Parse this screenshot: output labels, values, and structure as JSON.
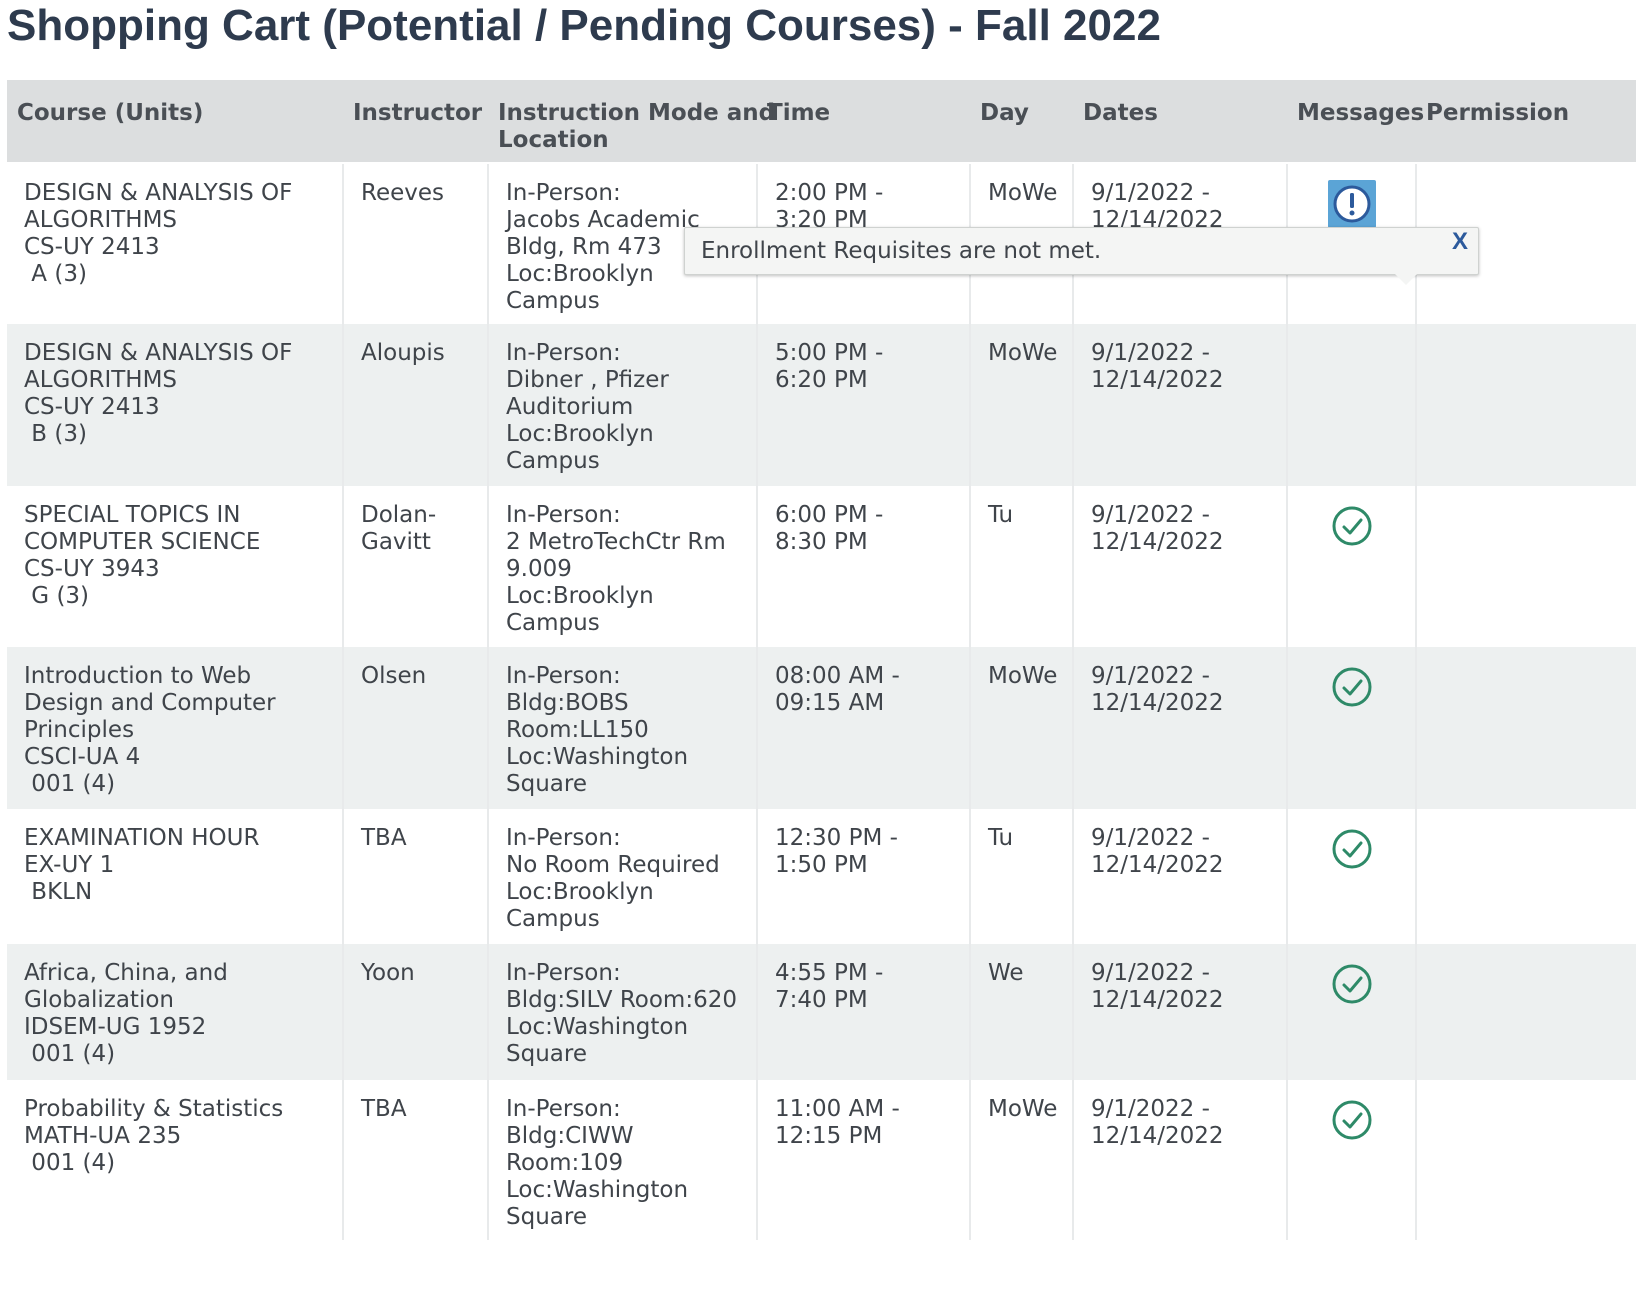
{
  "page": {
    "title": "Shopping Cart (Potential / Pending Courses) - Fall 2022"
  },
  "table": {
    "headers": {
      "course": "Course (Units)",
      "instructor": "Instructor",
      "mode_line1": "Instruction Mode and",
      "mode_line2": "Location",
      "time": "Time",
      "day": "Day",
      "dates": "Dates",
      "messages": "Messages",
      "permission": "Permission"
    },
    "rows": [
      {
        "title": [
          "DESIGN & ANALYSIS OF",
          "ALGORITHMS"
        ],
        "code": "CS-UY 2413",
        "section": " A (3)",
        "instructor": [
          "Reeves"
        ],
        "location": [
          "In-Person:",
          "Jacobs Academic",
          "Bldg, Rm 473",
          "Loc:Brooklyn",
          "Campus"
        ],
        "time": [
          "2:00 PM -",
          "3:20 PM"
        ],
        "day": "MoWe",
        "dates": [
          "9/1/2022 -",
          "12/14/2022"
        ],
        "message": "warning",
        "message_icon": "exclamation-icon",
        "permission": ""
      },
      {
        "title": [
          "DESIGN & ANALYSIS OF",
          "ALGORITHMS"
        ],
        "code": "CS-UY 2413",
        "section": " B (3)",
        "instructor": [
          "Aloupis"
        ],
        "location": [
          "In-Person:",
          "Dibner , Pfizer",
          "Auditorium",
          "Loc:Brooklyn",
          "Campus"
        ],
        "time": [
          "5:00 PM -",
          "6:20 PM"
        ],
        "day": "MoWe",
        "dates": [
          "9/1/2022 -",
          "12/14/2022"
        ],
        "message": "none",
        "message_icon": "",
        "permission": ""
      },
      {
        "title": [
          "SPECIAL TOPICS IN",
          "COMPUTER SCIENCE"
        ],
        "code": "CS-UY 3943",
        "section": " G (3)",
        "instructor": [
          "Dolan-",
          "Gavitt"
        ],
        "location": [
          "In-Person:",
          "2 MetroTechCtr Rm",
          "9.009",
          "Loc:Brooklyn",
          "Campus"
        ],
        "time": [
          "6:00 PM -",
          "8:30 PM"
        ],
        "day": "Tu",
        "dates": [
          "9/1/2022 -",
          "12/14/2022"
        ],
        "message": "ok",
        "message_icon": "check-circle-icon",
        "permission": ""
      },
      {
        "title": [
          "Introduction to Web",
          "Design and Computer",
          "Principles"
        ],
        "code": "CSCI-UA 4",
        "section": " 001 (4)",
        "instructor": [
          "Olsen"
        ],
        "location": [
          "In-Person:",
          "Bldg:BOBS",
          "Room:LL150",
          "Loc:Washington",
          "Square"
        ],
        "time": [
          "08:00 AM -",
          "09:15 AM"
        ],
        "day": "MoWe",
        "dates": [
          "9/1/2022 -",
          "12/14/2022"
        ],
        "message": "ok",
        "message_icon": "check-circle-icon",
        "permission": ""
      },
      {
        "title": [
          "EXAMINATION HOUR"
        ],
        "code": "EX-UY 1",
        "section": " BKLN",
        "instructor": [
          "TBA"
        ],
        "location": [
          "In-Person:",
          "No Room Required",
          "Loc:Brooklyn",
          "Campus"
        ],
        "time": [
          "12:30 PM -",
          "1:50 PM"
        ],
        "day": "Tu",
        "dates": [
          "9/1/2022 -",
          "12/14/2022"
        ],
        "message": "ok",
        "message_icon": "check-circle-icon",
        "permission": ""
      },
      {
        "title": [
          "Africa, China, and",
          "Globalization"
        ],
        "code": "IDSEM-UG 1952",
        "section": " 001 (4)",
        "instructor": [
          "Yoon"
        ],
        "location": [
          "In-Person:",
          "Bldg:SILV Room:620",
          "Loc:Washington",
          "Square"
        ],
        "time": [
          "4:55 PM -",
          "7:40 PM"
        ],
        "day": "We",
        "dates": [
          "9/1/2022 -",
          "12/14/2022"
        ],
        "message": "ok",
        "message_icon": "check-circle-icon",
        "permission": ""
      },
      {
        "title": [
          "Probability & Statistics"
        ],
        "code": "MATH-UA 235",
        "section": " 001 (4)",
        "instructor": [
          "TBA"
        ],
        "location": [
          "In-Person:",
          "Bldg:CIWW",
          "Room:109",
          "Loc:Washington",
          "Square"
        ],
        "time": [
          "11:00 AM -",
          "12:15 PM"
        ],
        "day": "MoWe",
        "dates": [
          "9/1/2022 -",
          "12/14/2022"
        ],
        "message": "ok",
        "message_icon": "check-circle-icon",
        "permission": ""
      }
    ]
  },
  "tooltip": {
    "text": "Enrollment Requisites are not met.",
    "close_label": "X"
  },
  "colors": {
    "header_bg": "#dcdedf",
    "row_alt_bg": "#edf0f0",
    "ok_green": "#2e8a68",
    "warning_blue": "#5ba4d6",
    "title_color": "#2e3b4e",
    "close_color": "#2c5a9c"
  }
}
